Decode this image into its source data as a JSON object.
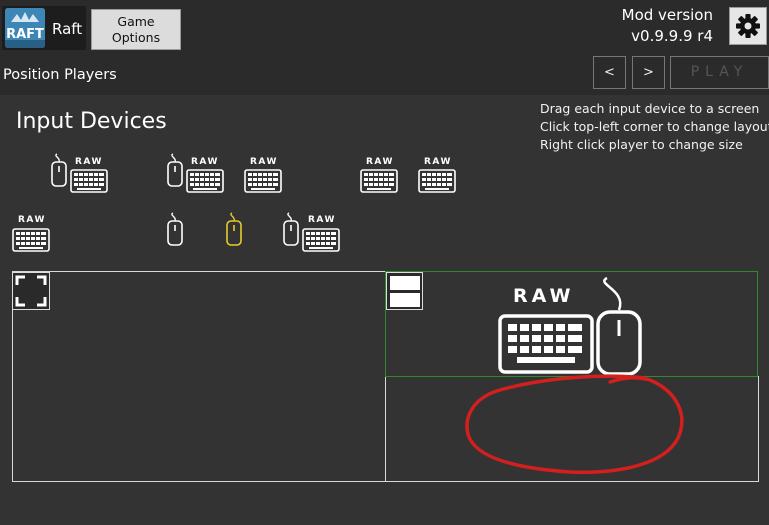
{
  "header": {
    "game_name": "Raft",
    "logo_text": "RAFT",
    "game_options_label": "Game\nOptions",
    "mod_version_label": "Mod version",
    "mod_version_value": "v0.9.9.9 r4",
    "settings_icon": "gear-icon"
  },
  "nav": {
    "page_title": "Position Players",
    "prev_label": "<",
    "next_label": ">",
    "play_label": "PLAY"
  },
  "devices": {
    "title": "Input Devices",
    "instructions": [
      "Drag each input device to a screen",
      "Click top-left corner to change layout",
      "Right click player to change size"
    ],
    "raw_label": "RAW",
    "highlight_color": "#e8cc2a"
  },
  "screens": {
    "active_border_color": "#2f8a2f",
    "annotation_color": "#d41f1f"
  }
}
